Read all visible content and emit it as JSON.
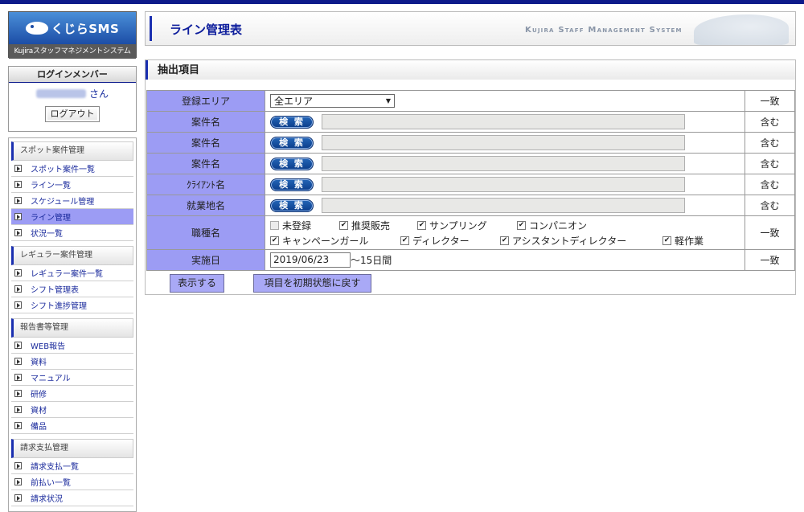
{
  "app": {
    "logo_text": "くじらSMS",
    "logo_subtitle": "Kujiraスタッフマネジメントシステム",
    "system_name": "Kujira Staff Management System"
  },
  "login": {
    "header": "ログインメンバー",
    "honorific": "さん",
    "logout_label": "ログアウト"
  },
  "menu": {
    "groups": [
      {
        "title": "スポット案件管理",
        "items": [
          "スポット案件一覧",
          "ライン一覧",
          "スケジュール管理",
          "ライン管理",
          "状況一覧"
        ],
        "active_index": 3
      },
      {
        "title": "レギュラー案件管理",
        "items": [
          "レギュラー案件一覧",
          "シフト管理表",
          "シフト進捗管理"
        ]
      },
      {
        "title": "報告書等管理",
        "items": [
          "WEB報告",
          "資料",
          "マニュアル",
          "研修",
          "資材",
          "備品"
        ]
      },
      {
        "title": "請求支払管理",
        "items": [
          "請求支払一覧",
          "前払い一覧",
          "請求状況"
        ]
      }
    ]
  },
  "page": {
    "title": "ライン管理表"
  },
  "filter": {
    "heading": "抽出項目",
    "area_label": "登録エリア",
    "area_value": "全エリア",
    "match_exact": "一致",
    "match_contains": "含む",
    "search_label": "検 索",
    "rows": [
      {
        "label": "案件名"
      },
      {
        "label": "案件名"
      },
      {
        "label": "案件名"
      },
      {
        "label": "ｸﾗｲｱﾝﾄ名"
      },
      {
        "label": "就業地名"
      }
    ],
    "job_label": "職種名",
    "job_types": [
      {
        "label": "未登録",
        "checked": false
      },
      {
        "label": "推奨販売",
        "checked": true
      },
      {
        "label": "サンプリング",
        "checked": true
      },
      {
        "label": "コンパニオン",
        "checked": true
      },
      {
        "label": "キャンペーンガール",
        "checked": true
      },
      {
        "label": "ディレクター",
        "checked": true
      },
      {
        "label": "アシスタントディレクター",
        "checked": true
      },
      {
        "label": "軽作業",
        "checked": true
      }
    ],
    "date_label": "実施日",
    "date_value": "2019/06/23",
    "date_suffix": "～15日間",
    "show_button": "表示する",
    "reset_button": "項目を初期状態に戻す"
  },
  "colors": {
    "accent": "#1a2fb0",
    "label_bg": "#9c9cf4",
    "link": "#1a2a9c"
  }
}
